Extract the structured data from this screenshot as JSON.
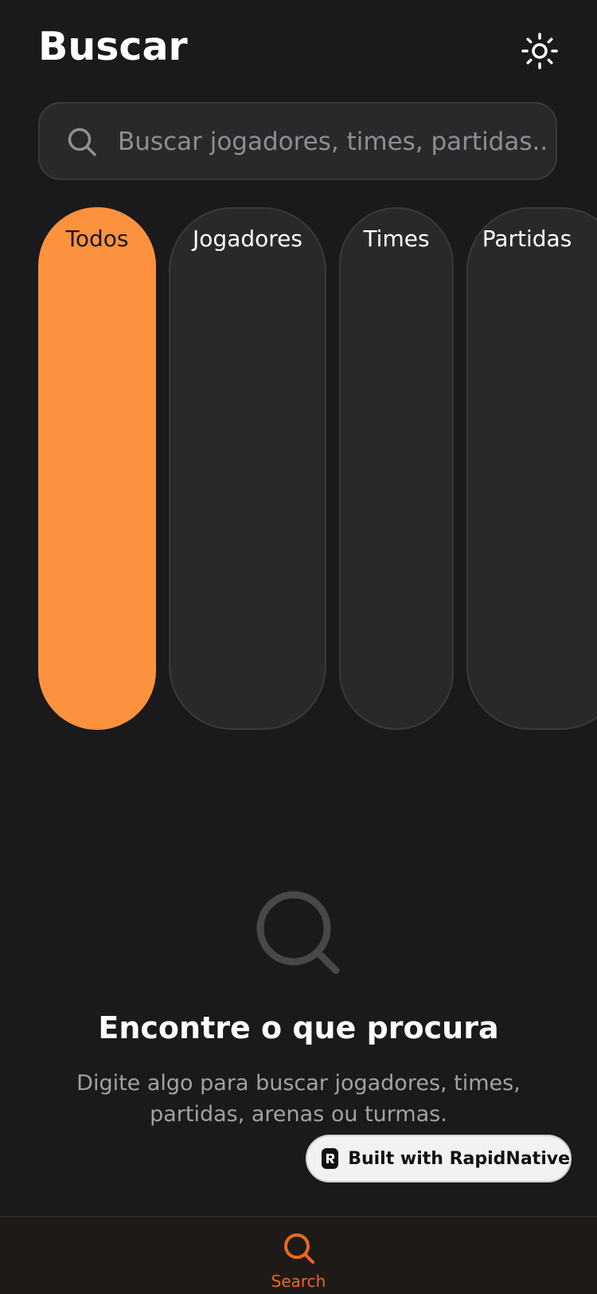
{
  "header": {
    "title": "Buscar",
    "theme_toggle_icon": "sun-icon"
  },
  "search": {
    "placeholder": "Buscar jogadores, times, partidas...",
    "value": "",
    "icon": "search-icon"
  },
  "filters": {
    "selected": "Todos",
    "items": [
      {
        "label": "Todos"
      },
      {
        "label": "Jogadores"
      },
      {
        "label": "Times"
      },
      {
        "label": "Partidas"
      }
    ]
  },
  "empty_state": {
    "icon": "search-icon",
    "title": "Encontre o que procura",
    "subtitle": "Digite algo para buscar jogadores, times, partidas, arenas ou turmas."
  },
  "badge": {
    "label": "Built with RapidNative"
  },
  "tabbar": {
    "items": [
      {
        "label": "Search",
        "icon": "search-icon",
        "active": true
      }
    ]
  },
  "colors": {
    "background": "#1a1a1c",
    "accent": "#fd923e",
    "tab_active": "#e8691e",
    "surface": "#29292c"
  }
}
